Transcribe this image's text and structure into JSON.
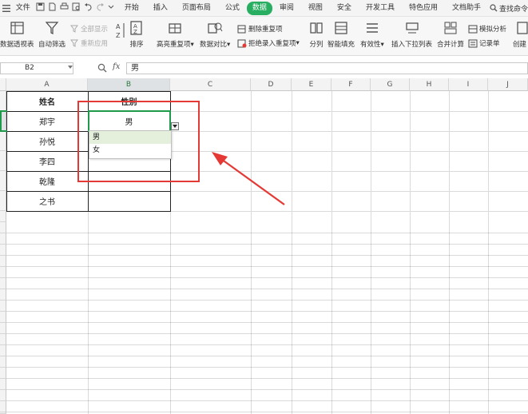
{
  "menubar": {
    "file_label": "文件",
    "tabs": [
      "开始",
      "插入",
      "页面布局",
      "公式",
      "数据",
      "审阅",
      "视图",
      "安全",
      "开发工具",
      "特色应用",
      "文档助手"
    ],
    "active_tab": "数据",
    "search_label": "查找命令",
    "accent_color": "#27ae60"
  },
  "ribbon": {
    "pivot_label": "数据透视表",
    "autofilter_label": "自动筛选",
    "show_all_label": "全部显示",
    "reapply_label": "重新应用",
    "sort_label": "排序",
    "highlight_dup_label": "高亮重复项",
    "compare_label": "数据对比",
    "remove_dup_label": "删除重复项",
    "reject_dup_label": "拒绝录入重复项",
    "split_label": "分列",
    "flash_fill_label": "智能填充",
    "validity_label": "有效性",
    "insert_dropdown_label": "插入下拉列表",
    "consolidate_label": "合并计算",
    "whatif_label": "模拟分析",
    "record_label": "记录单",
    "create_label": "创建"
  },
  "formula_bar": {
    "name_box": "B2",
    "fx_label": "fx",
    "value": "男"
  },
  "columns": [
    "A",
    "B",
    "C",
    "D",
    "E",
    "F",
    "G",
    "H",
    "I",
    "J"
  ],
  "selected_column": "B",
  "table": {
    "headers": [
      "姓名",
      "性别"
    ],
    "rows": [
      [
        "郑宇",
        "男"
      ],
      [
        "孙悦",
        ""
      ],
      [
        "李四",
        ""
      ],
      [
        "乾隆",
        ""
      ],
      [
        "之书",
        ""
      ]
    ]
  },
  "dropdown": {
    "options": [
      "男",
      "女"
    ],
    "selected": "男"
  },
  "annotation_color": "#e53935"
}
